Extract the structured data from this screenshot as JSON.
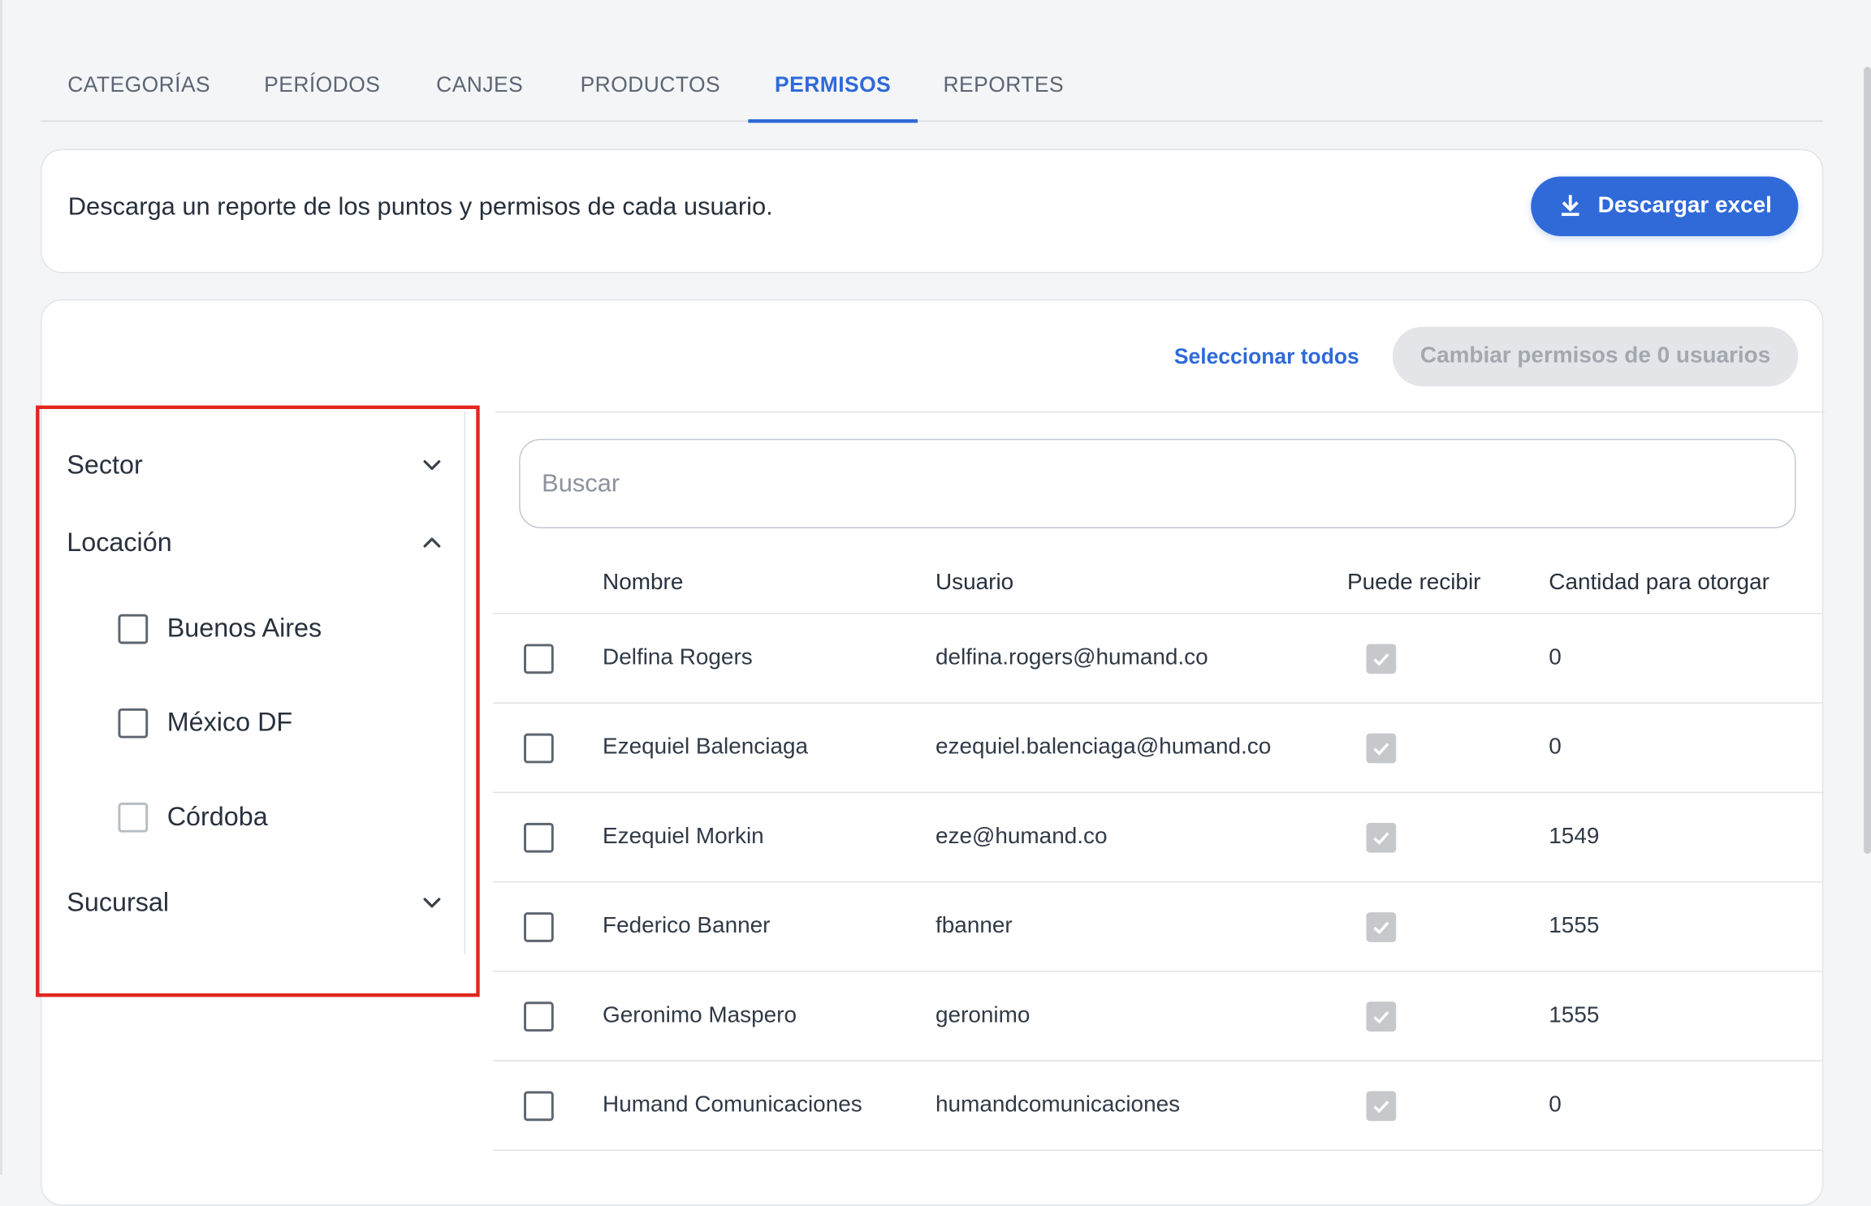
{
  "tabs": [
    {
      "label": "CATEGORÍAS",
      "active": false
    },
    {
      "label": "PERÍODOS",
      "active": false
    },
    {
      "label": "CANJES",
      "active": false
    },
    {
      "label": "PRODUCTOS",
      "active": false
    },
    {
      "label": "PERMISOS",
      "active": true
    },
    {
      "label": "REPORTES",
      "active": false
    }
  ],
  "download": {
    "description": "Descarga un reporte de los puntos y permisos de cada usuario.",
    "button_label": "Descargar excel",
    "icon": "download-icon"
  },
  "actions": {
    "select_all_label": "Seleccionar todos",
    "change_permissions_label": "Cambiar permisos de 0 usuarios"
  },
  "filters": {
    "sector": {
      "label": "Sector",
      "expanded": false
    },
    "location": {
      "label": "Locación",
      "expanded": true,
      "options": [
        {
          "label": "Buenos Aires",
          "checked": false
        },
        {
          "label": "México DF",
          "checked": false
        },
        {
          "label": "Córdoba",
          "checked": false
        }
      ]
    },
    "branch": {
      "label": "Sucursal",
      "expanded": false
    }
  },
  "search": {
    "placeholder": "Buscar",
    "value": ""
  },
  "table": {
    "headers": {
      "name": "Nombre",
      "user": "Usuario",
      "can_receive": "Puede recibir",
      "amount": "Cantidad para otorgar"
    },
    "rows": [
      {
        "name": "Delfina Rogers",
        "user": "delfina.rogers@humand.co",
        "can_receive": true,
        "amount": "0"
      },
      {
        "name": "Ezequiel Balenciaga",
        "user": "ezequiel.balenciaga@humand.co",
        "can_receive": true,
        "amount": "0"
      },
      {
        "name": "Ezequiel Morkin",
        "user": "eze@humand.co",
        "can_receive": true,
        "amount": "1549"
      },
      {
        "name": "Federico Banner",
        "user": "fbanner",
        "can_receive": true,
        "amount": "1555"
      },
      {
        "name": "Geronimo Maspero",
        "user": "geronimo",
        "can_receive": true,
        "amount": "1555"
      },
      {
        "name": "Humand Comunicaciones",
        "user": "humandcomunicaciones",
        "can_receive": true,
        "amount": "0"
      }
    ]
  },
  "colors": {
    "accent": "#2f6ad8",
    "highlight_border": "#e2261d",
    "disabled_bg": "#e4e5e8"
  }
}
